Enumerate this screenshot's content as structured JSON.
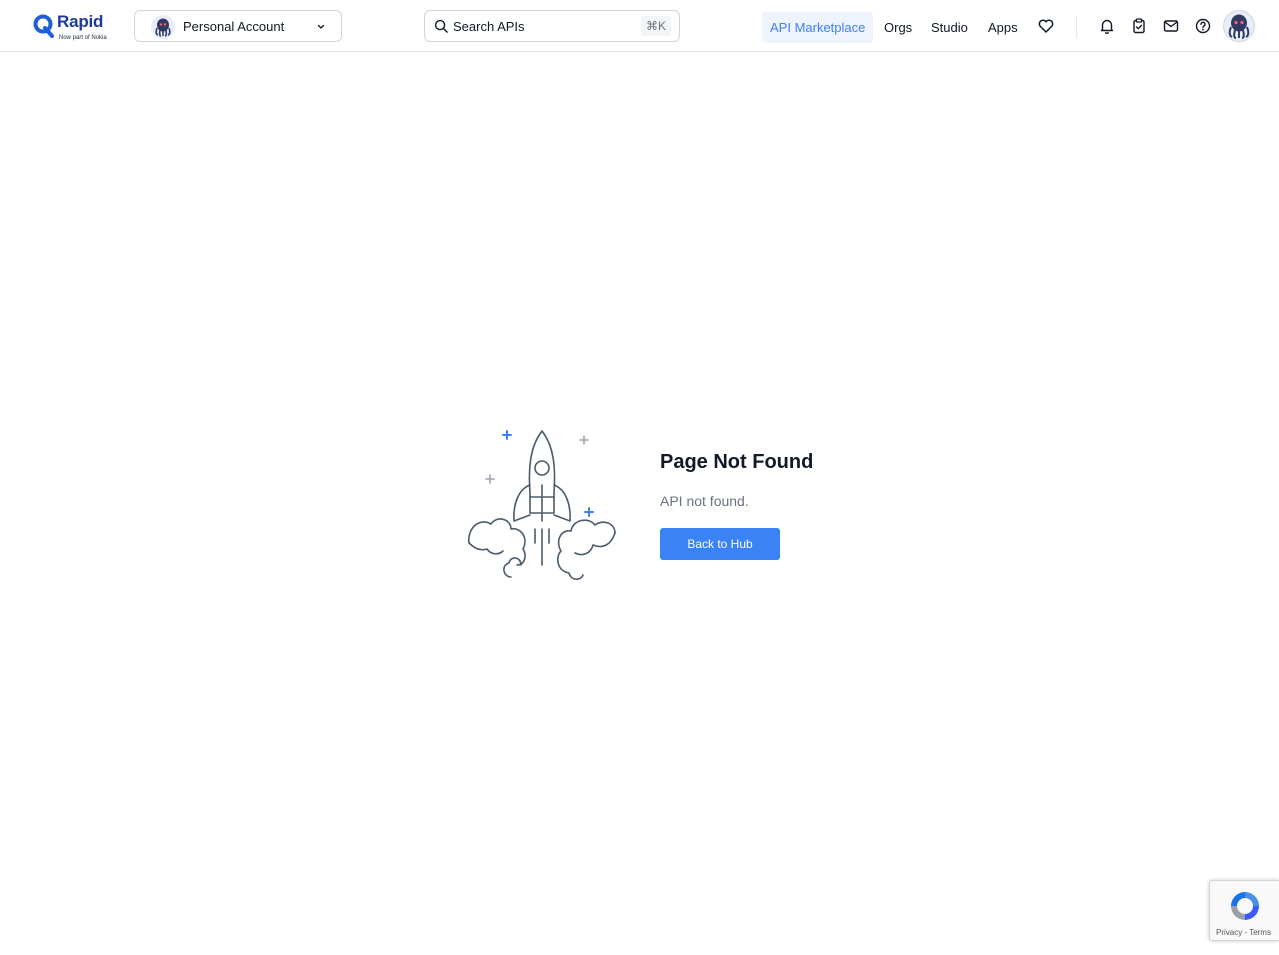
{
  "header": {
    "logo": {
      "name": "Rapid",
      "tagline": "Now part of Nokia",
      "brand_color": "#1f3b97"
    },
    "account_switcher": {
      "label": "Personal Account",
      "icon": "chevron-down-icon"
    },
    "search": {
      "placeholder": "Search APIs",
      "shortcut": "⌘K"
    },
    "nav": [
      {
        "label": "API Marketplace",
        "active": true
      },
      {
        "label": "Orgs",
        "active": false
      },
      {
        "label": "Studio",
        "active": false
      },
      {
        "label": "Apps",
        "active": false
      }
    ],
    "icons": [
      "heart-icon",
      "bell-icon",
      "clipboard-check-icon",
      "mail-icon",
      "help-circle-icon"
    ],
    "accent_color": "#3b82f6"
  },
  "main": {
    "title": "Page Not Found",
    "message": "API not found.",
    "button_label": "Back to Hub"
  },
  "recaptcha": {
    "links": "Privacy - Terms"
  }
}
